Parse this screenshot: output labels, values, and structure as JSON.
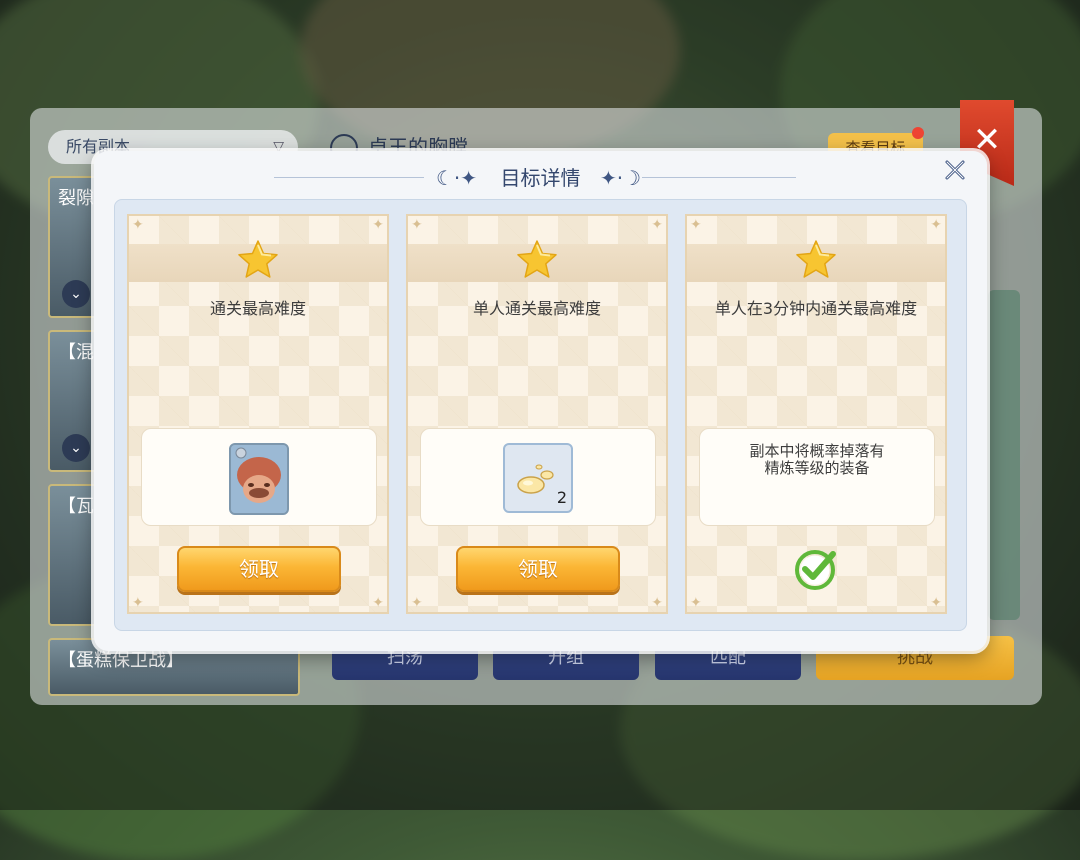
{
  "background": {
    "filter_label": "所有副本",
    "title": "卓王的胸膛",
    "goal_button": "查看目标",
    "list_items": [
      "裂隙",
      "【混沌",
      "【瓦尔",
      "【蛋糕保卫战】"
    ],
    "bottom_buttons": [
      "扫荡",
      "开组",
      "匹配",
      "挑战"
    ]
  },
  "modal": {
    "title": "目标详情",
    "close_icon": "close-icon",
    "cards": [
      {
        "goal": "通关最高难度",
        "reward_type": "item",
        "reward_icon": "character-head-item-icon",
        "button_label": "领取"
      },
      {
        "goal": "单人通关最高难度",
        "reward_type": "item",
        "reward_icon": "egg-item-icon",
        "reward_quantity": "2",
        "button_label": "领取"
      },
      {
        "goal": "单人在3分钟内通关最高难度",
        "reward_type": "note",
        "reward_note_line1": "副本中将概率掉落有",
        "reward_note_line2": "精炼等级的装备",
        "status_icon": "completed-check-icon"
      }
    ]
  },
  "colors": {
    "accent_blue": "#34476e",
    "button_orange": "#fbb635",
    "check_green": "#5fb83a",
    "star_gold": "#f7c531"
  }
}
